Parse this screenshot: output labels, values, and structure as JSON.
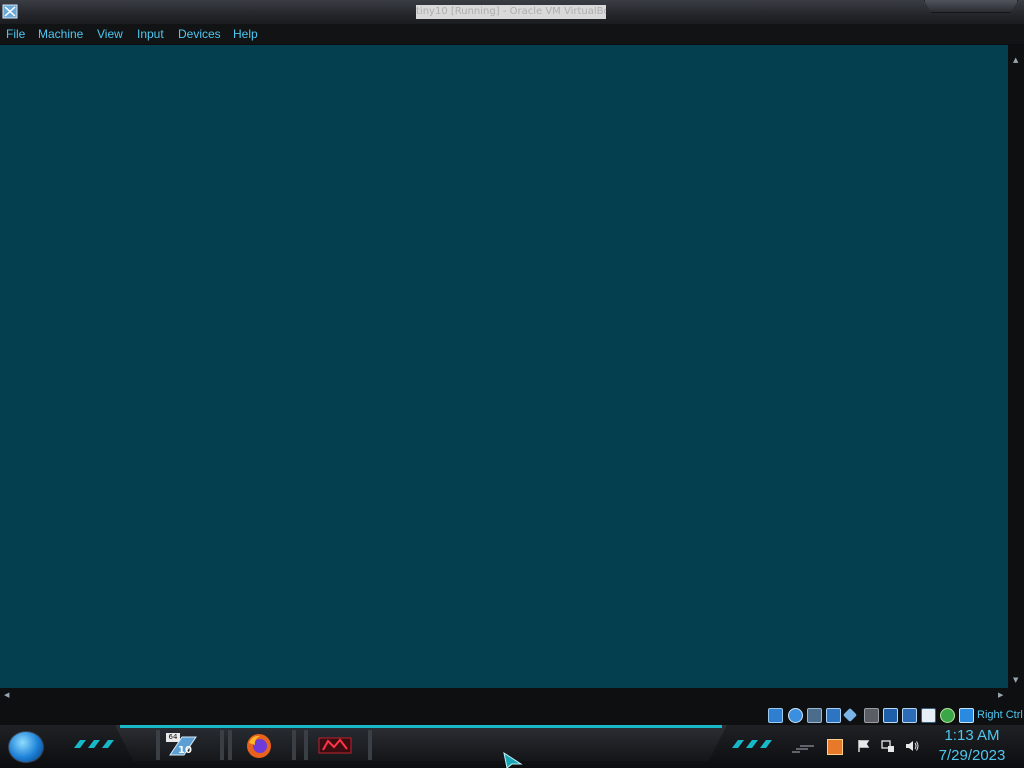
{
  "window": {
    "title": "tiny10 [Running] - Oracle VM VirtualBox",
    "app_icon": "virtualbox-icon"
  },
  "menubar": {
    "items": [
      {
        "label": "File"
      },
      {
        "label": "Machine"
      },
      {
        "label": "View"
      },
      {
        "label": "Input"
      },
      {
        "label": "Devices"
      },
      {
        "label": "Help"
      }
    ]
  },
  "guest_screen": {
    "background_color": "#033f4f"
  },
  "statusbar": {
    "icons": [
      "hard-disk-icon",
      "optical-drive-icon",
      "audio-icon",
      "network-icon",
      "usb-icon",
      "shared-folders-icon",
      "display-icon",
      "video-capture-icon",
      "virtualization-icon",
      "guest-additions-icon",
      "mouse-integration-icon"
    ],
    "host_key_label": "Right Ctrl"
  },
  "taskbar": {
    "start_button": "start-orb-icon",
    "pinned": [
      {
        "name": "tiny10-app",
        "badge_top": "64",
        "badge_bottom": "10"
      },
      {
        "name": "firefox"
      },
      {
        "name": "third-app"
      }
    ],
    "tray_icons": [
      "network-status-icon",
      "flag-icon",
      "connection-icon",
      "volume-icon"
    ],
    "clock_time": "1:13 AM",
    "clock_date": "7/29/2023"
  },
  "colors": {
    "accent": "#4fc7f0",
    "guest_bg": "#033f4f",
    "chrome_dark": "#0e0f11",
    "cyan_trim": "#18b8c8"
  }
}
